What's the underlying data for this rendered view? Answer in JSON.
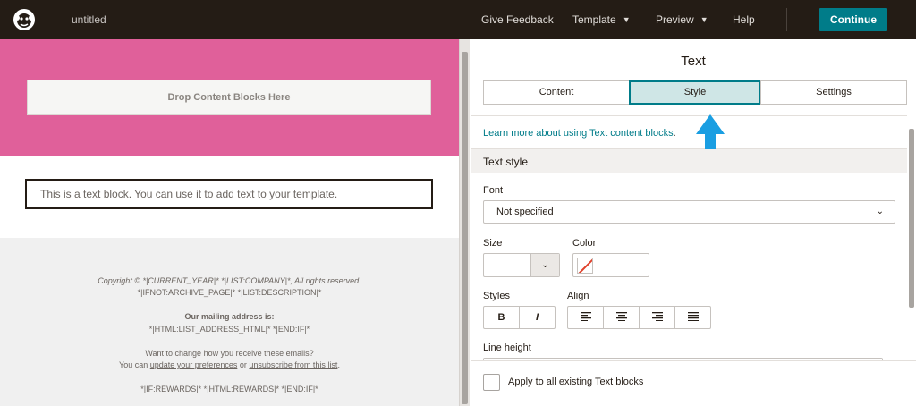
{
  "topbar": {
    "logo_icon": "mailchimp-freddie-icon",
    "document_title": "untitled",
    "nav": {
      "give_feedback": "Give Feedback",
      "template": "Template",
      "preview": "Preview",
      "help": "Help"
    },
    "continue_label": "Continue"
  },
  "canvas": {
    "drop_zone_label": "Drop Content Blocks Here",
    "text_block": "This is a text block. You can use it to add text to your template.",
    "footer": {
      "copyright": "Copyright © *|CURRENT_YEAR|* *|LIST:COMPANY|*, All rights reserved.",
      "archive_line": "*|IFNOT:ARCHIVE_PAGE|* *|LIST:DESCRIPTION|*",
      "mailing_heading": "Our mailing address is:",
      "address_line": "*|HTML:LIST_ADDRESS_HTML|* *|END:IF|*",
      "change_question": "Want to change how you receive these emails?",
      "you_can": "You can",
      "update_link": "update your preferences",
      "or": "or",
      "unsubscribe_link": "unsubscribe from this list",
      "period": ".",
      "rewards_line": "*|IF:REWARDS|* *|HTML:REWARDS|* *|END:IF|*"
    },
    "accent_color": "#e0609a"
  },
  "panel": {
    "title": "Text",
    "tabs": [
      {
        "label": "Content",
        "active": false
      },
      {
        "label": "Style",
        "active": true
      },
      {
        "label": "Settings",
        "active": false
      }
    ],
    "learn_link": "Learn more about using Text content blocks",
    "learn_suffix": ".",
    "section_title": "Text style",
    "font_label": "Font",
    "font_value": "Not specified",
    "size_label": "Size",
    "size_value": "",
    "color_label": "Color",
    "styles_label": "Styles",
    "styles_buttons": [
      "B",
      "I"
    ],
    "align_label": "Align",
    "align_icons": [
      "align-left-icon",
      "align-center-icon",
      "align-right-icon",
      "align-justify-icon"
    ],
    "line_height_label": "Line height",
    "apply_label": "Apply to all existing Text blocks",
    "apply_checked": false,
    "brand_color": "#007c89",
    "arrow_color": "#1a9ee2"
  }
}
